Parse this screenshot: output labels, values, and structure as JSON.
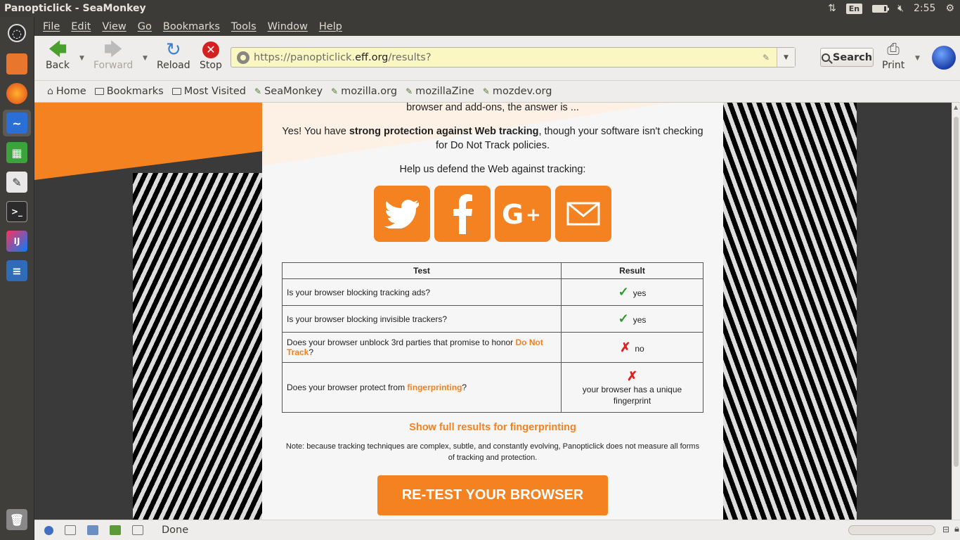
{
  "window": {
    "title": "Panopticlick - SeaMonkey",
    "keyboard": "En",
    "clock": "2:55"
  },
  "menu": [
    "File",
    "Edit",
    "View",
    "Go",
    "Bookmarks",
    "Tools",
    "Window",
    "Help"
  ],
  "nav": {
    "back": "Back",
    "forward": "Forward",
    "reload": "Reload",
    "stop": "Stop",
    "url_prefix": "https://panopticlick.",
    "url_domain": "eff.org",
    "url_suffix": "/results?",
    "search": "Search",
    "print": "Print"
  },
  "bookmarks": [
    "Home",
    "Bookmarks",
    "Most Visited",
    "SeaMonkey",
    "mozilla.org",
    "mozillaZine",
    "mozdev.org"
  ],
  "page": {
    "intro": "browser and add-ons, the answer is ...",
    "verdict_prefix": "Yes! You have ",
    "verdict_bold": "strong protection against Web tracking",
    "verdict_suffix": ", though your software isn't checking for Do Not Track policies.",
    "help": "Help us defend the Web against tracking:",
    "share": [
      "twitter-icon",
      "facebook-icon",
      "google-plus-icon",
      "email-icon"
    ],
    "table": {
      "col_test": "Test",
      "col_result": "Result",
      "rows": [
        {
          "test": "Is your browser blocking tracking ads?",
          "mark": "✓",
          "result": "yes"
        },
        {
          "test": "Is your browser blocking invisible trackers?",
          "mark": "✓",
          "result": "yes"
        },
        {
          "test_prefix": "Does your browser unblock 3rd parties that promise to honor ",
          "test_link": "Do Not Track",
          "test_suffix": "?",
          "mark": "✗",
          "result": "no"
        },
        {
          "test_prefix": "Does your browser protect from ",
          "test_link": "fingerprinting",
          "test_suffix": "?",
          "mark": "✗",
          "result": "your browser has a unique fingerprint"
        }
      ]
    },
    "full_results": "Show full results for fingerprinting",
    "note": "Note: because tracking techniques are complex, subtle, and constantly evolving, Panopticlick does not measure all forms of tracking and protection.",
    "retest": "RE-TEST YOUR BROWSER"
  },
  "status": {
    "text": "Done"
  },
  "colors": {
    "accent": "#f58220",
    "check": "#2c9a2c",
    "cross": "#e02020"
  }
}
